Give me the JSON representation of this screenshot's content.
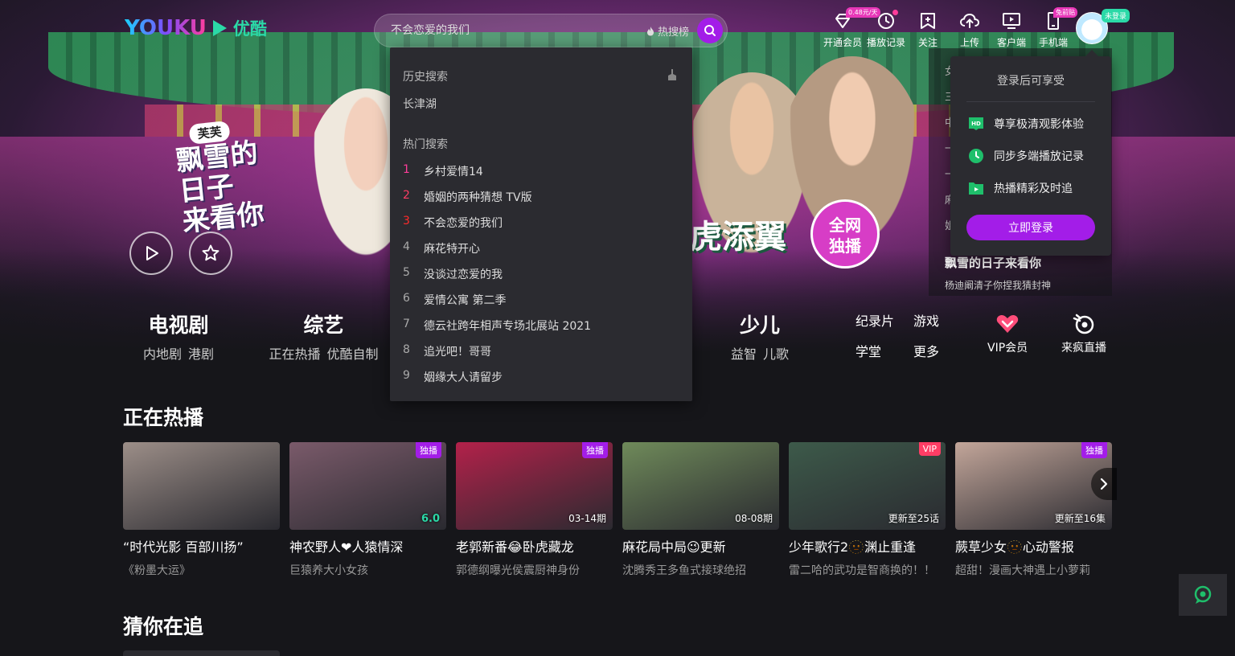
{
  "brand": {
    "logo_en": "YOUKU",
    "logo_cn": "优酷"
  },
  "search": {
    "placeholder": "不会恋爱的我们",
    "hot_label": "热搜榜"
  },
  "nav": [
    {
      "label": "开通会员",
      "icon": "diamond-icon",
      "tag": "0.48元/天"
    },
    {
      "label": "播放记录",
      "icon": "clock-icon",
      "dot": true
    },
    {
      "label": "关注",
      "icon": "bookmark-plus-icon"
    },
    {
      "label": "上传",
      "icon": "cloud-upload-icon"
    },
    {
      "label": "客户端",
      "icon": "monitor-play-icon"
    },
    {
      "label": "手机端",
      "icon": "phone-icon",
      "tag": "兔前贴"
    }
  ],
  "user": {
    "login_tag": "未登录"
  },
  "dropdown": {
    "history_title": "历史搜索",
    "history": [
      "长津湖"
    ],
    "hot_title": "热门搜索",
    "hot": [
      {
        "rank": "1",
        "text": "乡村爱情14"
      },
      {
        "rank": "2",
        "text": "婚姻的两种猜想 TV版"
      },
      {
        "rank": "3",
        "text": "不会恋爱的我们"
      },
      {
        "rank": "4",
        "text": "麻花特开心"
      },
      {
        "rank": "5",
        "text": "没谈过恋爱的我"
      },
      {
        "rank": "6",
        "text": "爱情公寓 第二季"
      },
      {
        "rank": "7",
        "text": "德云社跨年相声专场北展站 2021"
      },
      {
        "rank": "8",
        "text": "追光吧！哥哥"
      },
      {
        "rank": "9",
        "text": "姻缘大人请留步"
      }
    ]
  },
  "login_popover": {
    "title": "登录后可享受",
    "benefits": [
      {
        "icon": "hd-icon",
        "text": "尊享极清观影体验"
      },
      {
        "icon": "history-icon",
        "text": "同步多端播放记录"
      },
      {
        "icon": "folder-play-icon",
        "text": "热播精彩及时追"
      }
    ],
    "button": "立即登录"
  },
  "hero": {
    "art_badge": "芙芙",
    "art_title_1": "飘雪的",
    "art_title_2": "日子",
    "art_title_3": "来看你",
    "promo_text": "虎添翼",
    "exclusive_text": "全网\n独播",
    "side_items": [
      "女",
      "三",
      "中",
      "一",
      "一",
      "麻",
      "姐"
    ],
    "current_title": "飘雪的日子来看你",
    "current_sub": "杨迪阚清子你捏我猜封神"
  },
  "categories": [
    {
      "title": "电视剧",
      "subs": [
        "内地剧",
        "港剧"
      ]
    },
    {
      "title": "综艺",
      "subs": [
        "正在热播",
        "优酷自制"
      ]
    },
    {
      "title": "少儿",
      "subs": [
        "益智",
        "儿歌"
      ]
    }
  ],
  "small_categories": [
    "纪录片",
    "游戏",
    "学堂",
    "更多"
  ],
  "icon_categories": [
    {
      "label": "VIP会员",
      "icon": "vip-heart-icon"
    },
    {
      "label": "来疯直播",
      "icon": "laifeng-icon"
    }
  ],
  "sections": {
    "hot_now": "正在热播",
    "guess": "猜你在追"
  },
  "cards": [
    {
      "title": "“时代光影 百部川扬”",
      "sub": "《粉墨大运》",
      "badge": "",
      "corner": "",
      "bg": "#9c8e88"
    },
    {
      "title": "神农野人❤人猿情深",
      "sub": "巨猿养大小女孩",
      "badge": "独播",
      "corner": "6.0",
      "bg": "#7a5a6a"
    },
    {
      "title": "老郭新番😂卧虎藏龙",
      "sub": "郭德纲曝光侯震厨神身份",
      "badge": "独播",
      "corner": "03-14期",
      "bg": "#b3214a"
    },
    {
      "title": "麻花局中局😉更新",
      "sub": "沈腾秀王多鱼式接球绝招",
      "badge": "",
      "corner": "08-08期",
      "bg": "#6f8a5a"
    },
    {
      "title": "少年歌行2🫥渊止重逢",
      "sub": "雷二哈的武功是智商换的！！",
      "badge": "VIP",
      "corner": "更新至25话",
      "bg": "#3d5a4a"
    },
    {
      "title": "蕨草少女🫥心动警报",
      "sub": "超甜！漫画大神遇上小萝莉",
      "badge": "独播",
      "corner": "更新至16集",
      "bg": "#c3a69a"
    }
  ]
}
